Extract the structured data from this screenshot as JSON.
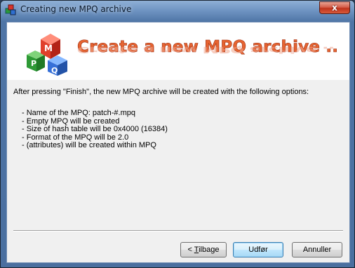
{
  "window": {
    "title": "Creating new MPQ archive",
    "close_glyph": "x"
  },
  "banner": {
    "title": "Create a new MPQ archive ..",
    "logo_letters": [
      "M",
      "P",
      "Q"
    ],
    "title_color": "#e66431"
  },
  "intro_text": "After pressing \"Finish\", the new MPQ archive will be created with the following options:",
  "options": [
    "- Name of the MPQ: patch-#.mpq",
    "- Empty MPQ will be created",
    "- Size of hash table will be 0x4000 (16384)",
    "- Format of the MPQ will be 2.0",
    "- (attributes) will be created within MPQ"
  ],
  "buttons": {
    "back_prefix": "< ",
    "back_underlined": "T",
    "back_rest": "ilbage",
    "finish": "Udfør",
    "cancel": "Annuller"
  }
}
